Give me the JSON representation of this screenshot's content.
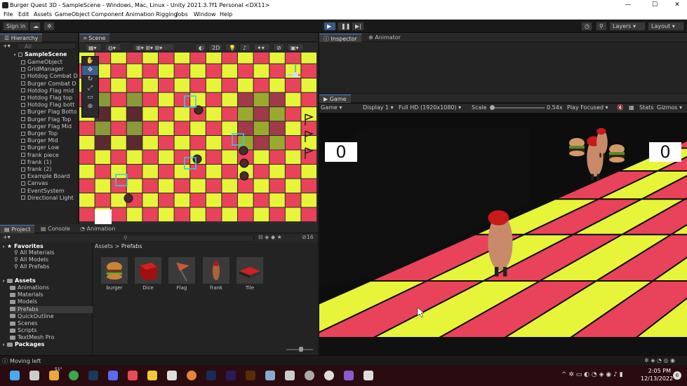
{
  "window": {
    "title": "Burger Quest 3D - SampleScene - Windows, Mac, Linux - Unity 2021.3.7f1 Personal <DX11>"
  },
  "menu": [
    "File",
    "Edit",
    "Assets",
    "GameObject",
    "Component",
    "Animation Rigging",
    "Jobs",
    "Window",
    "Help"
  ],
  "toolbar": {
    "signin": "Sign in",
    "layers": "Layers",
    "layout": "Layout"
  },
  "hierarchy": {
    "tab": "Hierarchy",
    "search_placeholder": "All",
    "root": "SampleScene",
    "items": [
      "GameObject",
      "GridManager",
      "Hotdog Combat D",
      "Burger Combat D",
      "Hotdog Flag mid",
      "Hotdog Flag top",
      "Hotdog Flag bott",
      "Burger Flag Botto",
      "Burger Flag Top",
      "Burger Flag Mid",
      "Burger Top",
      "Burger Mid",
      "Burger Low",
      "frank piece",
      "frank (1)",
      "frank (2)",
      "Example Board",
      "Canvas",
      "EventSystem",
      "Directional Light"
    ]
  },
  "scene": {
    "tab": "Scene",
    "mode2d": "2D"
  },
  "inspector": {
    "tab": "Inspector",
    "tab2": "Animator"
  },
  "game": {
    "tab": "Game",
    "mode": "Game",
    "display": "Display 1",
    "resolution": "Full HD (1920x1080)",
    "scale_label": "Scale",
    "scale_value": "0.54x",
    "play_focused": "Play Focused",
    "stats": "Stats",
    "gizmos": "Gizmos",
    "score_left": "0",
    "score_right": "0"
  },
  "project": {
    "tabs": [
      "Project",
      "Console",
      "Animation"
    ],
    "count": "16",
    "favorites_label": "Favorites",
    "favorites": [
      "All Materials",
      "All Models",
      "All Prefabs"
    ],
    "assets_label": "Assets",
    "folders": [
      "Animations",
      "Materials",
      "Models",
      "Prefabs",
      "QuickOutline",
      "Scenes",
      "Scripts",
      "TextMesh Pro"
    ],
    "packages_label": "Packages",
    "breadcrumb": [
      "Assets",
      "Prefabs"
    ],
    "prefabs": [
      "burger",
      "Dice",
      "Flag",
      "frank",
      "Tile"
    ]
  },
  "status": {
    "text": "Moving left"
  },
  "taskbar": {
    "time": "2:05 PM",
    "date": "12/13/2022",
    "weather": "51°",
    "notif": "6"
  },
  "colors": {
    "red": "#e8435a",
    "yellow": "#e6f53a",
    "accent": "#4a7bd0"
  }
}
